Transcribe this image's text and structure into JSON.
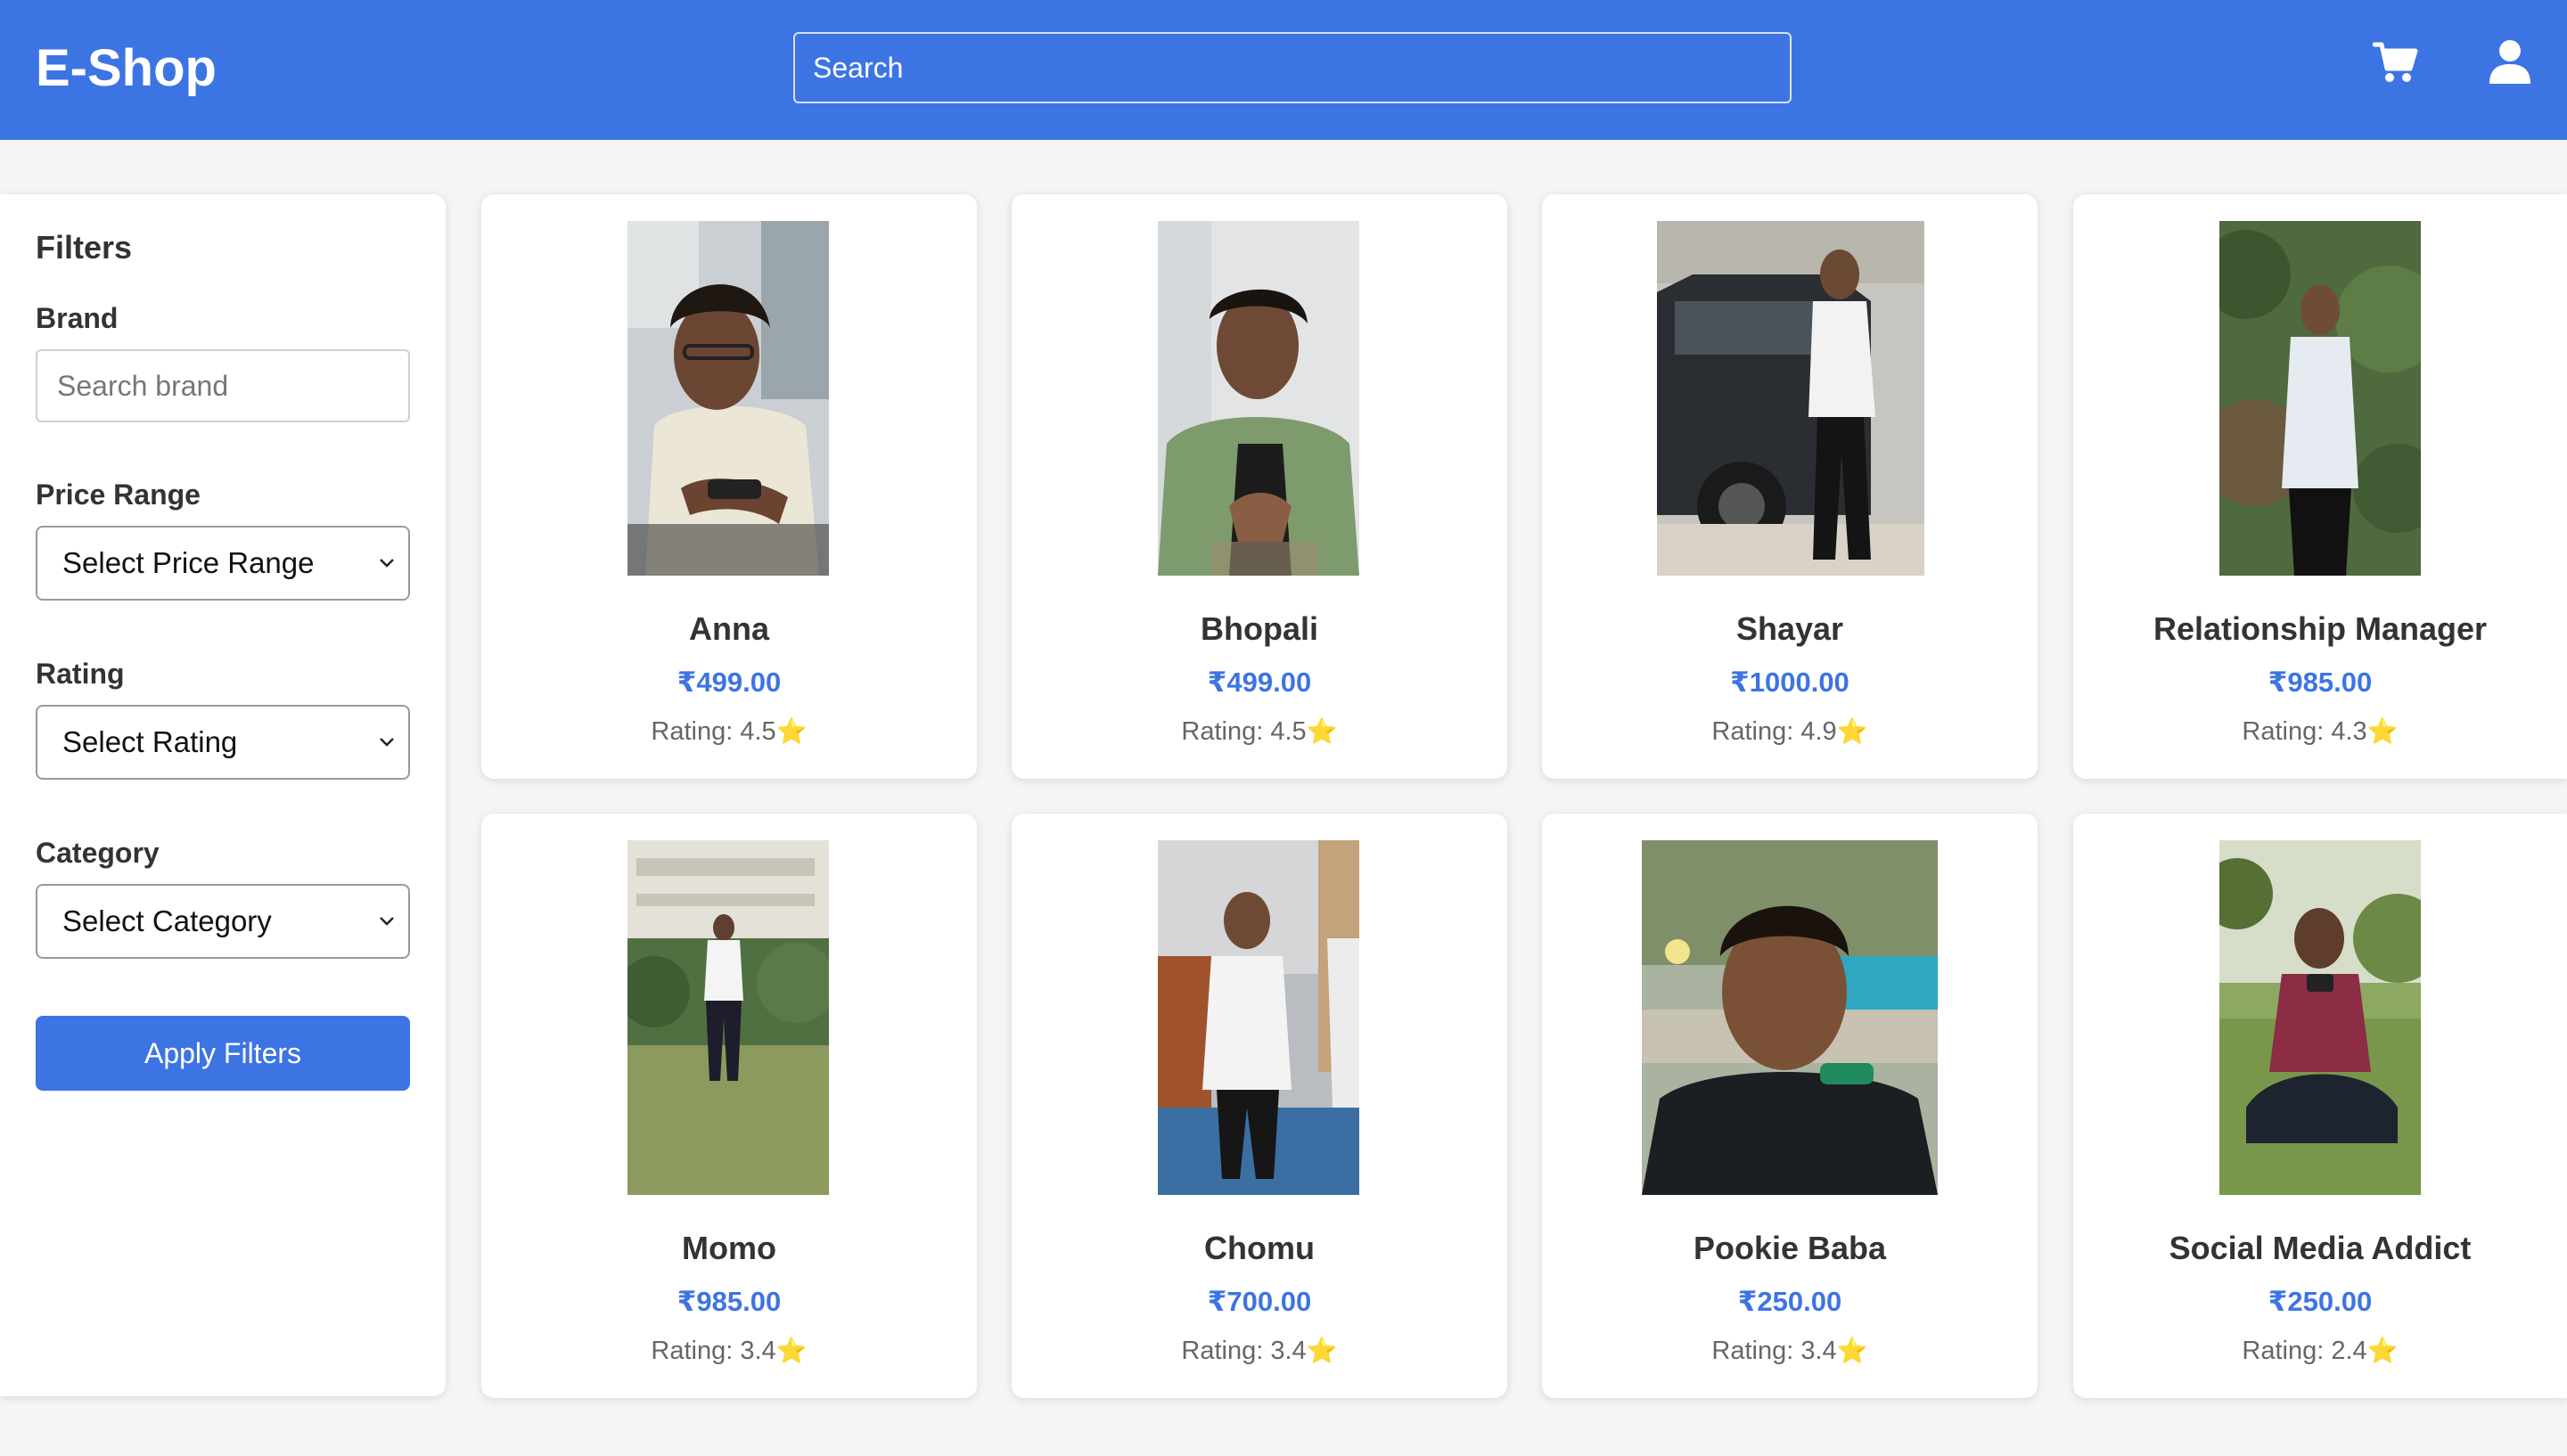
{
  "header": {
    "logo": "E-Shop",
    "search_placeholder": "Search",
    "cart_icon": "shopping-cart-icon",
    "user_icon": "user-icon",
    "color": "#3d74e3"
  },
  "sidebar": {
    "title": "Filters",
    "brand_label": "Brand",
    "brand_placeholder": "Search brand",
    "price_label": "Price Range",
    "price_selected": "Select Price Range",
    "rating_label": "Rating",
    "rating_selected": "Select Rating",
    "category_label": "Category",
    "category_selected": "Select Category",
    "apply_label": "Apply Filters"
  },
  "rating_prefix": "Rating: ",
  "products": [
    {
      "name": "Anna",
      "price": "₹499.00",
      "rating": "4.5"
    },
    {
      "name": "Bhopali",
      "price": "₹499.00",
      "rating": "4.5"
    },
    {
      "name": "Shayar",
      "price": "₹1000.00",
      "rating": "4.9"
    },
    {
      "name": "Relationship Manager",
      "price": "₹985.00",
      "rating": "4.3"
    },
    {
      "name": "Momo",
      "price": "₹985.00",
      "rating": "3.4"
    },
    {
      "name": "Chomu",
      "price": "₹700.00",
      "rating": "3.4"
    },
    {
      "name": "Pookie Baba",
      "price": "₹250.00",
      "rating": "3.4"
    },
    {
      "name": "Social Media Addict",
      "price": "₹250.00",
      "rating": "2.4"
    }
  ]
}
